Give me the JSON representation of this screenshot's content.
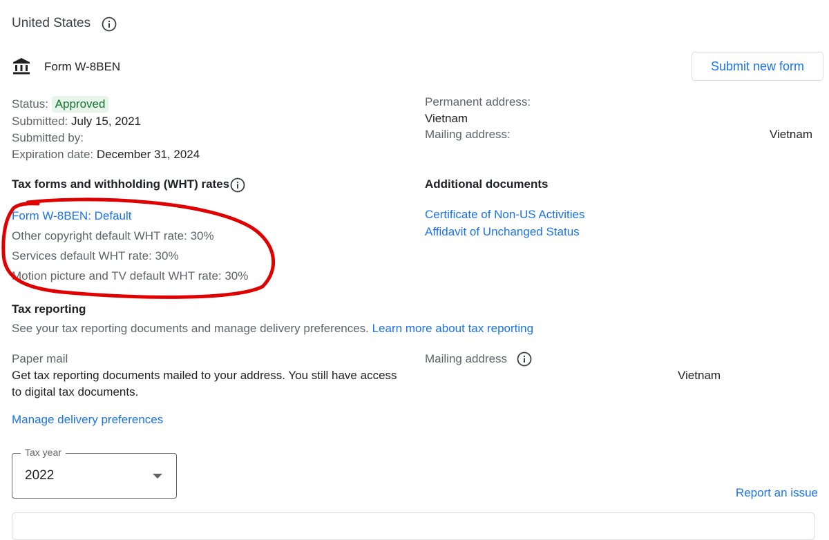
{
  "header": {
    "country": "United States",
    "info_icon": "info-circle-icon"
  },
  "form": {
    "icon": "bank-icon",
    "title": "Form W-8BEN",
    "submit_button": "Submit new form"
  },
  "status": {
    "status_label": "Status:",
    "status_value": "Approved",
    "submitted_label": "Submitted:",
    "submitted_value": "July 15, 2021",
    "submitted_by_label": "Submitted by:",
    "submitted_by_value": "",
    "expiration_label": "Expiration date:",
    "expiration_value": "December 31, 2024"
  },
  "addresses": {
    "permanent_label": "Permanent address:",
    "permanent_value": "Vietnam",
    "mailing_label": "Mailing address:",
    "mailing_value": "Vietnam"
  },
  "tax_forms": {
    "heading": "Tax forms and withholding (WHT) rates",
    "form_link": "Form W-8BEN: Default",
    "rates": [
      "Other copyright default WHT rate: 30%",
      "Services default WHT rate: 30%",
      "Motion picture and TV default WHT rate: 30%"
    ]
  },
  "additional_documents": {
    "heading": "Additional documents",
    "links": [
      "Certificate of Non-US Activities",
      "Affidavit of Unchanged Status"
    ]
  },
  "tax_reporting": {
    "heading": "Tax reporting",
    "description": "See your tax reporting documents and manage delivery preferences.",
    "learn_more": "Learn more about tax reporting",
    "paper_mail_label": "Paper mail",
    "paper_mail_desc_line1": "Get tax reporting documents mailed to your address. You still have access",
    "paper_mail_desc_line2": "to digital tax documents.",
    "mailing_label": "Mailing address",
    "mailing_value": "Vietnam",
    "manage_link": "Manage delivery preferences"
  },
  "tax_year": {
    "label": "Tax year",
    "value": "2022"
  },
  "report_issue": "Report an issue",
  "colors": {
    "link": "#1a73e8",
    "approved_bg": "#e6f4ea",
    "approved_text": "#137333",
    "annotation_red": "#e00000"
  }
}
